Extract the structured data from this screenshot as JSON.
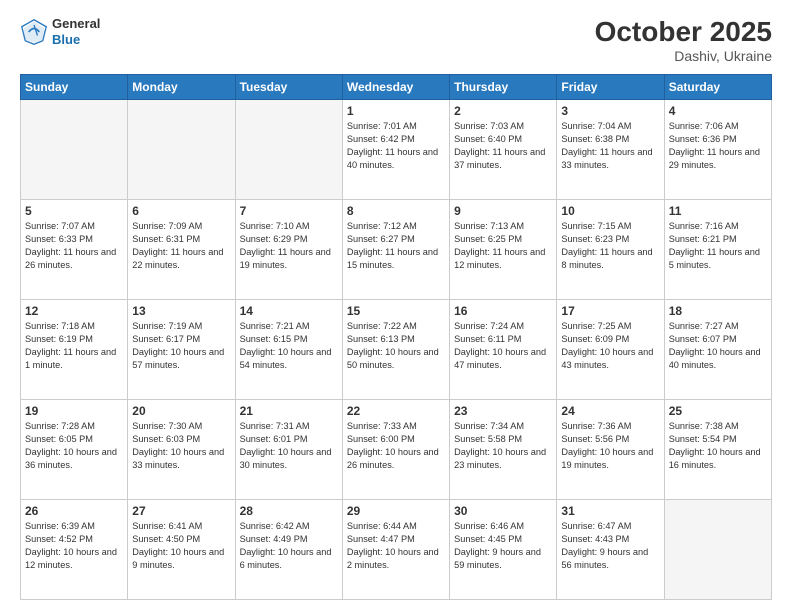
{
  "header": {
    "logo": {
      "general": "General",
      "blue": "Blue"
    },
    "title": "October 2025",
    "location": "Dashiv, Ukraine"
  },
  "weekdays": [
    "Sunday",
    "Monday",
    "Tuesday",
    "Wednesday",
    "Thursday",
    "Friday",
    "Saturday"
  ],
  "weeks": [
    [
      {
        "day": "",
        "text": ""
      },
      {
        "day": "",
        "text": ""
      },
      {
        "day": "",
        "text": ""
      },
      {
        "day": "1",
        "text": "Sunrise: 7:01 AM\nSunset: 6:42 PM\nDaylight: 11 hours\nand 40 minutes."
      },
      {
        "day": "2",
        "text": "Sunrise: 7:03 AM\nSunset: 6:40 PM\nDaylight: 11 hours\nand 37 minutes."
      },
      {
        "day": "3",
        "text": "Sunrise: 7:04 AM\nSunset: 6:38 PM\nDaylight: 11 hours\nand 33 minutes."
      },
      {
        "day": "4",
        "text": "Sunrise: 7:06 AM\nSunset: 6:36 PM\nDaylight: 11 hours\nand 29 minutes."
      }
    ],
    [
      {
        "day": "5",
        "text": "Sunrise: 7:07 AM\nSunset: 6:33 PM\nDaylight: 11 hours\nand 26 minutes."
      },
      {
        "day": "6",
        "text": "Sunrise: 7:09 AM\nSunset: 6:31 PM\nDaylight: 11 hours\nand 22 minutes."
      },
      {
        "day": "7",
        "text": "Sunrise: 7:10 AM\nSunset: 6:29 PM\nDaylight: 11 hours\nand 19 minutes."
      },
      {
        "day": "8",
        "text": "Sunrise: 7:12 AM\nSunset: 6:27 PM\nDaylight: 11 hours\nand 15 minutes."
      },
      {
        "day": "9",
        "text": "Sunrise: 7:13 AM\nSunset: 6:25 PM\nDaylight: 11 hours\nand 12 minutes."
      },
      {
        "day": "10",
        "text": "Sunrise: 7:15 AM\nSunset: 6:23 PM\nDaylight: 11 hours\nand 8 minutes."
      },
      {
        "day": "11",
        "text": "Sunrise: 7:16 AM\nSunset: 6:21 PM\nDaylight: 11 hours\nand 5 minutes."
      }
    ],
    [
      {
        "day": "12",
        "text": "Sunrise: 7:18 AM\nSunset: 6:19 PM\nDaylight: 11 hours\nand 1 minute."
      },
      {
        "day": "13",
        "text": "Sunrise: 7:19 AM\nSunset: 6:17 PM\nDaylight: 10 hours\nand 57 minutes."
      },
      {
        "day": "14",
        "text": "Sunrise: 7:21 AM\nSunset: 6:15 PM\nDaylight: 10 hours\nand 54 minutes."
      },
      {
        "day": "15",
        "text": "Sunrise: 7:22 AM\nSunset: 6:13 PM\nDaylight: 10 hours\nand 50 minutes."
      },
      {
        "day": "16",
        "text": "Sunrise: 7:24 AM\nSunset: 6:11 PM\nDaylight: 10 hours\nand 47 minutes."
      },
      {
        "day": "17",
        "text": "Sunrise: 7:25 AM\nSunset: 6:09 PM\nDaylight: 10 hours\nand 43 minutes."
      },
      {
        "day": "18",
        "text": "Sunrise: 7:27 AM\nSunset: 6:07 PM\nDaylight: 10 hours\nand 40 minutes."
      }
    ],
    [
      {
        "day": "19",
        "text": "Sunrise: 7:28 AM\nSunset: 6:05 PM\nDaylight: 10 hours\nand 36 minutes."
      },
      {
        "day": "20",
        "text": "Sunrise: 7:30 AM\nSunset: 6:03 PM\nDaylight: 10 hours\nand 33 minutes."
      },
      {
        "day": "21",
        "text": "Sunrise: 7:31 AM\nSunset: 6:01 PM\nDaylight: 10 hours\nand 30 minutes."
      },
      {
        "day": "22",
        "text": "Sunrise: 7:33 AM\nSunset: 6:00 PM\nDaylight: 10 hours\nand 26 minutes."
      },
      {
        "day": "23",
        "text": "Sunrise: 7:34 AM\nSunset: 5:58 PM\nDaylight: 10 hours\nand 23 minutes."
      },
      {
        "day": "24",
        "text": "Sunrise: 7:36 AM\nSunset: 5:56 PM\nDaylight: 10 hours\nand 19 minutes."
      },
      {
        "day": "25",
        "text": "Sunrise: 7:38 AM\nSunset: 5:54 PM\nDaylight: 10 hours\nand 16 minutes."
      }
    ],
    [
      {
        "day": "26",
        "text": "Sunrise: 6:39 AM\nSunset: 4:52 PM\nDaylight: 10 hours\nand 12 minutes."
      },
      {
        "day": "27",
        "text": "Sunrise: 6:41 AM\nSunset: 4:50 PM\nDaylight: 10 hours\nand 9 minutes."
      },
      {
        "day": "28",
        "text": "Sunrise: 6:42 AM\nSunset: 4:49 PM\nDaylight: 10 hours\nand 6 minutes."
      },
      {
        "day": "29",
        "text": "Sunrise: 6:44 AM\nSunset: 4:47 PM\nDaylight: 10 hours\nand 2 minutes."
      },
      {
        "day": "30",
        "text": "Sunrise: 6:46 AM\nSunset: 4:45 PM\nDaylight: 9 hours\nand 59 minutes."
      },
      {
        "day": "31",
        "text": "Sunrise: 6:47 AM\nSunset: 4:43 PM\nDaylight: 9 hours\nand 56 minutes."
      },
      {
        "day": "",
        "text": ""
      }
    ]
  ]
}
